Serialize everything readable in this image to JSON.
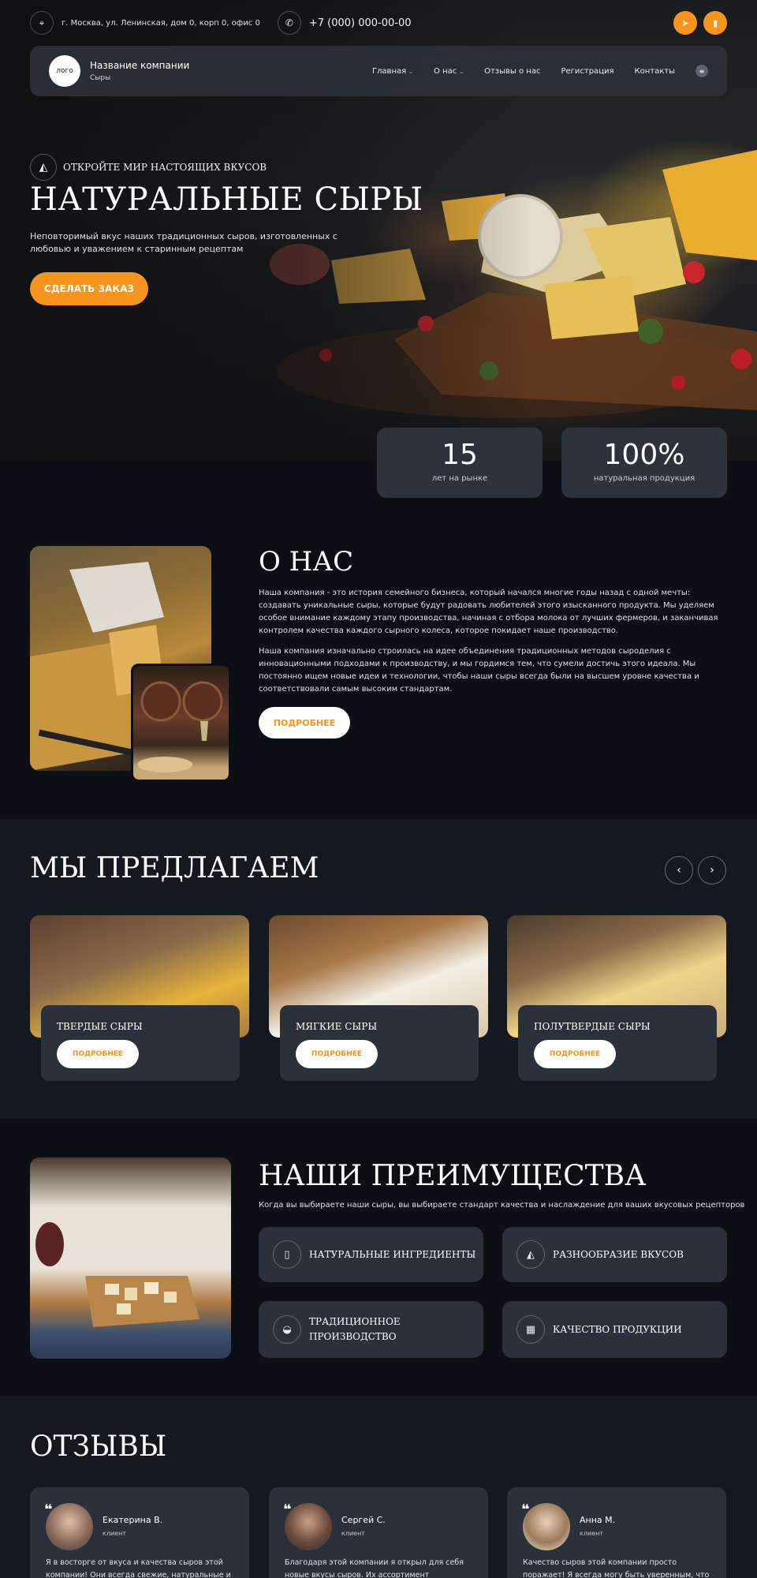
{
  "topbar": {
    "address": "г. Москва, ул. Ленинская, дом 0, корп 0, офис 0",
    "phone": "+7 (000) 000-00-00",
    "address_icon": "location-pin-icon",
    "phone_icon": "phone-icon",
    "social": [
      "telegram-icon",
      "whatsapp-icon"
    ]
  },
  "header": {
    "logo_text": "лого",
    "company_name": "Название компании",
    "company_sub": "Сыры",
    "nav": [
      {
        "label": "Главная",
        "has_dropdown": true
      },
      {
        "label": "О нас",
        "has_dropdown": true
      },
      {
        "label": "Отзывы о нас",
        "has_dropdown": false
      },
      {
        "label": "Регистрация",
        "has_dropdown": false
      },
      {
        "label": "Контакты",
        "has_dropdown": false
      }
    ]
  },
  "hero": {
    "tagline": "ОТКРОЙТЕ МИР НАСТОЯЩИХ ВКУСОВ",
    "title": "НАТУРАЛЬНЫЕ СЫРЫ",
    "description": "Неповторимый вкус наших традиционных сыров, изготовленных с любовью и уважением к старинным рецептам",
    "cta": "СДЕЛАТЬ ЗАКАЗ"
  },
  "stats": [
    {
      "value": "15",
      "label": "лет на рынке"
    },
    {
      "value": "100%",
      "label": "натуральная продукция"
    }
  ],
  "about": {
    "title": "О НАС",
    "p1": "Наша компания - это история семейного бизнеса, который начался многие годы назад с одной мечты: создавать уникальные сыры, которые будут радовать любителей этого изысканного продукта. Мы уделяем особое внимание каждому этапу производства, начиная с отбора молока от лучших фермеров, и заканчивая контролем качества каждого сырного колеса, которое покидает наше производство.",
    "p2": "Наша компания изначально строилась на идее объединения традиционных методов сыроделия с инновационными подходами к производству, и мы гордимся тем, что сумели достичь этого идеала. Мы постоянно ищем новые идеи и технологии, чтобы наши сыры всегда были на высшем уровне качества и соответствовали самым высоким стандартам.",
    "button": "ПОДРОБНЕЕ"
  },
  "offer": {
    "title": "МЫ ПРЕДЛАГАЕМ",
    "items": [
      {
        "name": "ТВЕРДЫЕ СЫРЫ",
        "button": "ПОДРОБНЕЕ"
      },
      {
        "name": "МЯГКИЕ СЫРЫ",
        "button": "ПОДРОБНЕЕ"
      },
      {
        "name": "ПОЛУТВЕРДЫЕ СЫРЫ",
        "button": "ПОДРОБНЕЕ"
      }
    ]
  },
  "advantages": {
    "title": "НАШИ ПРЕИМУЩЕСТВА",
    "subtitle": "Когда вы выбираете наши сыры, вы выбираете стандарт качества и наслаждение для ваших вкусовых рецепторов",
    "items": [
      {
        "label": "НАТУРАЛЬНЫЕ ИНГРЕДИЕНТЫ",
        "icon": "milk-bottle-icon"
      },
      {
        "label": "РАЗНООБРАЗИЕ ВКУСОВ",
        "icon": "cheese-icon"
      },
      {
        "label": "ТРАДИЦИОННОЕ ПРОИЗВОДСТВО",
        "icon": "cheese-wheel-icon"
      },
      {
        "label": "КАЧЕСТВО ПРОДУКЦИИ",
        "icon": "cheese-board-icon"
      }
    ]
  },
  "reviews": {
    "title": "ОТЗЫВЫ",
    "items": [
      {
        "name": "Екатерина В.",
        "role": "клиент",
        "text": "Я в восторге от вкуса и качества сыров этой компании! Они всегда свежие, натуральные и"
      },
      {
        "name": "Сергей С.",
        "role": "клиент",
        "text": "Благодаря этой компании я открыл для себя новые вкусы сыров. Их ассортимент настолько"
      },
      {
        "name": "Анна М.",
        "role": "клиент",
        "text": "Качество сыров этой компании просто поражает! Я всегда могу быть уверенным, что каждый"
      }
    ]
  },
  "colors": {
    "accent": "#f7941d",
    "card": "#2a313a",
    "background": "#0c0f13"
  }
}
